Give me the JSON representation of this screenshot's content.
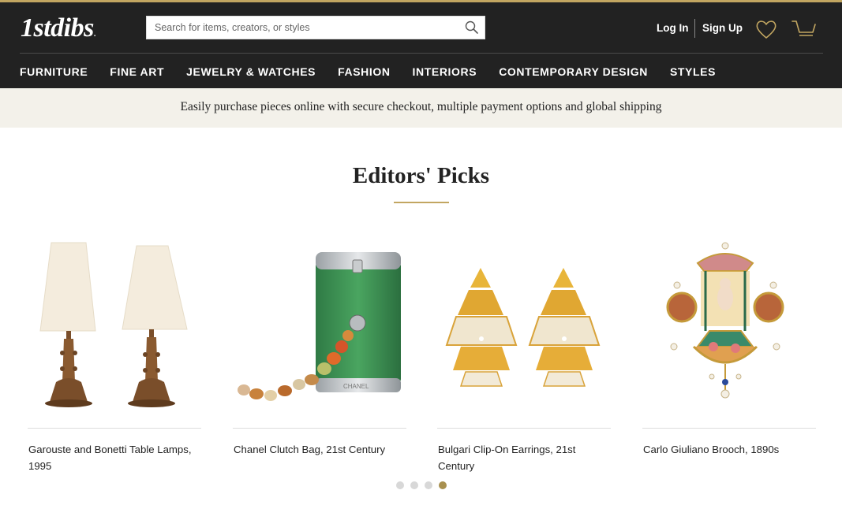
{
  "header": {
    "logo_text": "1stdibs",
    "logo_suffix": ".",
    "search": {
      "placeholder": "Search for items, creators, or styles",
      "value": ""
    },
    "login_label": "Log In",
    "signup_label": "Sign Up",
    "icons": [
      "search-icon",
      "heart-icon",
      "cart-icon"
    ],
    "accent_color": "#c2a661"
  },
  "nav": {
    "items": [
      "FURNITURE",
      "FINE ART",
      "JEWELRY & WATCHES",
      "FASHION",
      "INTERIORS",
      "CONTEMPORARY DESIGN",
      "STYLES"
    ]
  },
  "banner": {
    "text": "Easily purchase pieces online with secure checkout, multiple payment options and global shipping"
  },
  "editors_picks": {
    "title": "Editors' Picks",
    "items": [
      {
        "caption": "Garouste and Bonetti Table Lamps, 1995"
      },
      {
        "caption": "Chanel Clutch Bag, 21st Century"
      },
      {
        "caption": "Bulgari Clip-On Earrings, 21st Century"
      },
      {
        "caption": "Carlo Giuliano Brooch, 1890s"
      }
    ],
    "carousel": {
      "page_count": 4,
      "active_page": 4
    },
    "clutch_engraving": "CHANEL"
  }
}
